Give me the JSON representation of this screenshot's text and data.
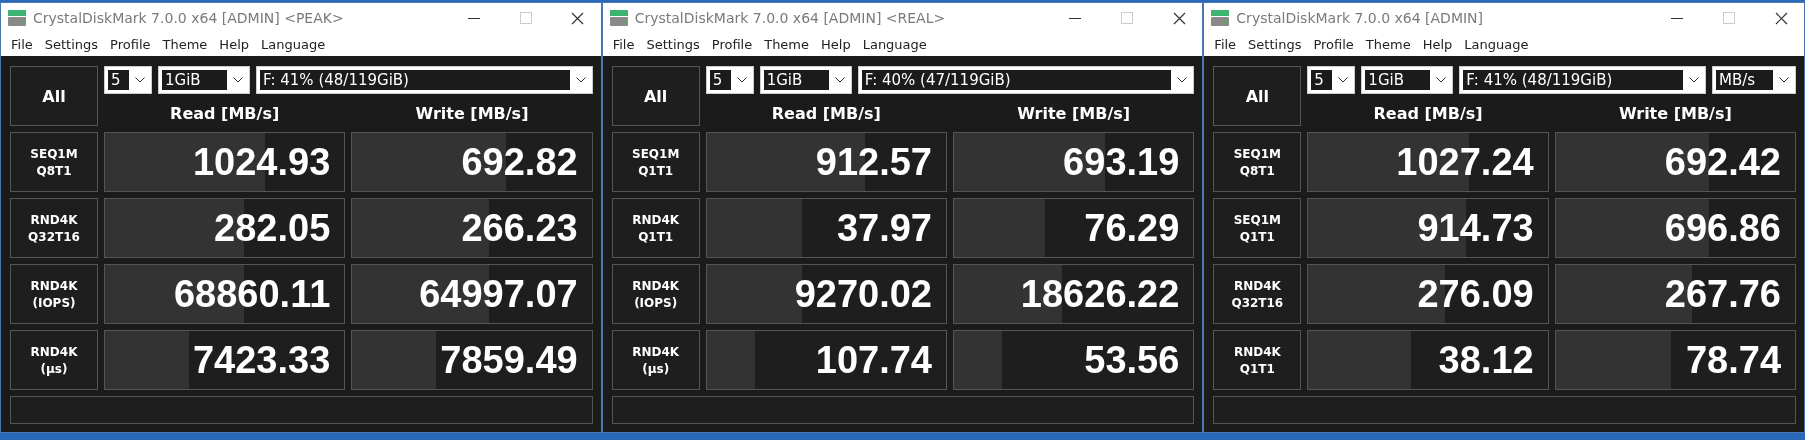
{
  "windows": [
    {
      "title": "CrystalDiskMark 7.0.0 x64 [ADMIN] <PEAK>",
      "menu": [
        "File",
        "Settings",
        "Profile",
        "Theme",
        "Help",
        "Language"
      ],
      "all_button": "All",
      "selectors": [
        {
          "kind": "count",
          "value": "5"
        },
        {
          "kind": "size",
          "value": "1GiB"
        },
        {
          "kind": "drive",
          "value": "F: 41% (48/119GiB)"
        }
      ],
      "headers": [
        "Read [MB/s]",
        "Write [MB/s]"
      ],
      "rows": [
        {
          "test": "SEQ1M",
          "params": "Q8T1",
          "read": {
            "value": "1024.93",
            "level": 0.67
          },
          "write": {
            "value": "692.82",
            "level": 0.64
          }
        },
        {
          "test": "RND4K",
          "params": "Q32T16",
          "read": {
            "value": "282.05",
            "level": 0.58
          },
          "write": {
            "value": "266.23",
            "level": 0.57
          }
        },
        {
          "test": "RND4K",
          "params": "(IOPS)",
          "read": {
            "value": "68860.11",
            "level": 0.58
          },
          "write": {
            "value": "64997.07",
            "level": 0.57
          }
        },
        {
          "test": "RND4K",
          "params": "(μs)",
          "read": {
            "value": "7423.33",
            "level": 0.35
          },
          "write": {
            "value": "7859.49",
            "level": 0.35
          }
        }
      ]
    },
    {
      "title": "CrystalDiskMark 7.0.0 x64 [ADMIN] <REAL>",
      "menu": [
        "File",
        "Settings",
        "Profile",
        "Theme",
        "Help",
        "Language"
      ],
      "all_button": "All",
      "selectors": [
        {
          "kind": "count",
          "value": "5"
        },
        {
          "kind": "size",
          "value": "1GiB"
        },
        {
          "kind": "drive",
          "value": "F: 40% (47/119GiB)"
        }
      ],
      "headers": [
        "Read [MB/s]",
        "Write [MB/s]"
      ],
      "rows": [
        {
          "test": "SEQ1M",
          "params": "Q1T1",
          "read": {
            "value": "912.57",
            "level": 0.66
          },
          "write": {
            "value": "693.19",
            "level": 0.63
          }
        },
        {
          "test": "RND4K",
          "params": "Q1T1",
          "read": {
            "value": "37.97",
            "level": 0.4
          },
          "write": {
            "value": "76.29",
            "level": 0.38
          }
        },
        {
          "test": "RND4K",
          "params": "(IOPS)",
          "read": {
            "value": "9270.02",
            "level": 0.4
          },
          "write": {
            "value": "18626.22",
            "level": 0.45
          }
        },
        {
          "test": "RND4K",
          "params": "(μs)",
          "read": {
            "value": "107.74",
            "level": 0.2
          },
          "write": {
            "value": "53.56",
            "level": 0.2
          }
        }
      ]
    },
    {
      "title": "CrystalDiskMark 7.0.0 x64 [ADMIN]",
      "menu": [
        "File",
        "Settings",
        "Profile",
        "Theme",
        "Help",
        "Language"
      ],
      "all_button": "All",
      "selectors": [
        {
          "kind": "count",
          "value": "5"
        },
        {
          "kind": "size",
          "value": "1GiB"
        },
        {
          "kind": "drive",
          "value": "F: 41% (48/119GiB)"
        },
        {
          "kind": "unit",
          "value": "MB/s"
        }
      ],
      "headers": [
        "Read [MB/s]",
        "Write [MB/s]"
      ],
      "rows": [
        {
          "test": "SEQ1M",
          "params": "Q8T1",
          "read": {
            "value": "1027.24",
            "level": 0.67
          },
          "write": {
            "value": "692.42",
            "level": 0.64
          }
        },
        {
          "test": "SEQ1M",
          "params": "Q1T1",
          "read": {
            "value": "914.73",
            "level": 0.66
          },
          "write": {
            "value": "696.86",
            "level": 0.64
          }
        },
        {
          "test": "RND4K",
          "params": "Q32T16",
          "read": {
            "value": "276.09",
            "level": 0.57
          },
          "write": {
            "value": "267.76",
            "level": 0.57
          }
        },
        {
          "test": "RND4K",
          "params": "Q1T1",
          "read": {
            "value": "38.12",
            "level": 0.43
          },
          "write": {
            "value": "78.74",
            "level": 0.48
          }
        }
      ]
    }
  ]
}
